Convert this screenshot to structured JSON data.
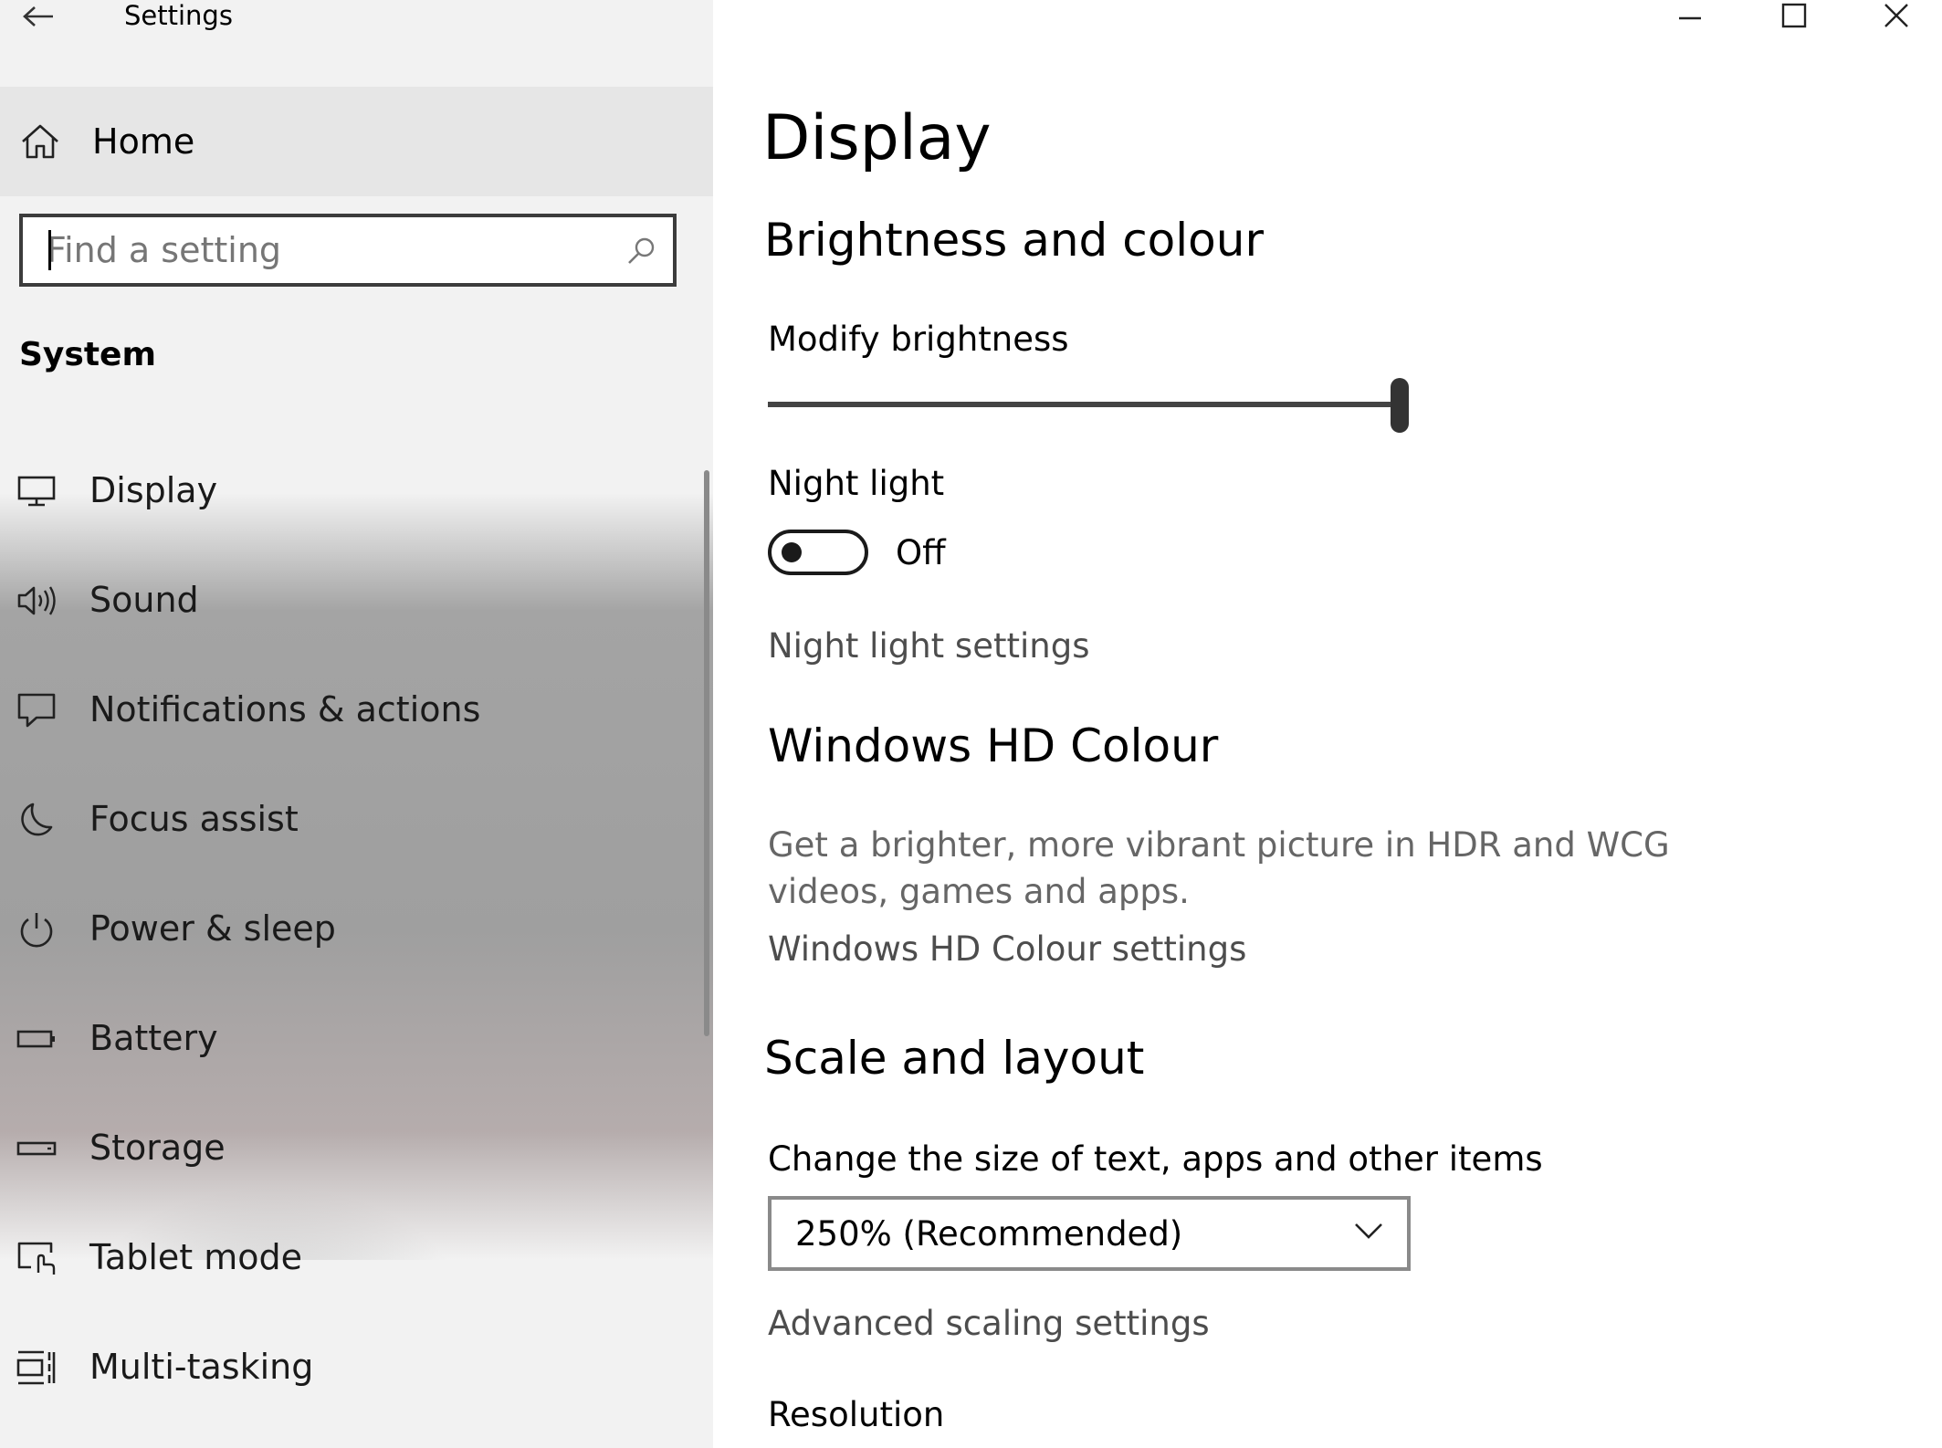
{
  "window": {
    "title": "Settings"
  },
  "sidebar": {
    "home_label": "Home",
    "search_placeholder": "Find a setting",
    "section_title": "System",
    "items": [
      {
        "label": "Display",
        "icon": "monitor-icon"
      },
      {
        "label": "Sound",
        "icon": "speaker-icon"
      },
      {
        "label": "Notifications & actions",
        "icon": "notification-icon"
      },
      {
        "label": "Focus assist",
        "icon": "moon-icon"
      },
      {
        "label": "Power & sleep",
        "icon": "power-icon"
      },
      {
        "label": "Battery",
        "icon": "battery-icon"
      },
      {
        "label": "Storage",
        "icon": "storage-icon"
      },
      {
        "label": "Tablet mode",
        "icon": "tablet-mode-icon"
      },
      {
        "label": "Multi-tasking",
        "icon": "multitasking-icon"
      }
    ]
  },
  "main": {
    "page_title": "Display",
    "brightness_section": {
      "heading": "Brightness and colour",
      "slider_label": "Modify brightness",
      "brightness_level_fraction": 1.0
    },
    "night_light": {
      "label": "Night light",
      "state": "Off",
      "settings_link": "Night light settings"
    },
    "hd_colour": {
      "heading": "Windows HD Colour",
      "description": "Get a brighter, more vibrant picture in HDR and WCG videos, games and apps.",
      "settings_link": "Windows HD Colour settings"
    },
    "scale_layout": {
      "heading": "Scale and layout",
      "size_label": "Change the size of text, apps and other items",
      "selected_scale": "250% (Recommended)",
      "advanced_link": "Advanced scaling settings",
      "resolution_label": "Resolution"
    }
  },
  "colors": {
    "sidebar_bg": "#f2f2f2",
    "home_bg": "#e6e6e6",
    "text_primary": "#000000",
    "link_text": "#4d4d4d"
  }
}
